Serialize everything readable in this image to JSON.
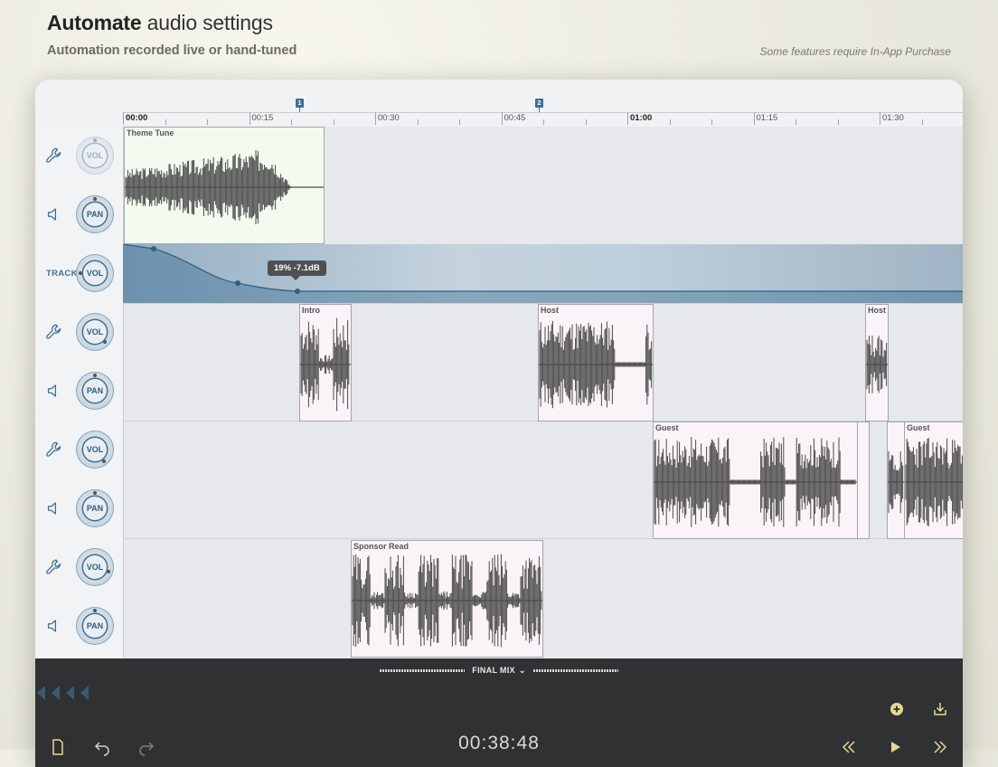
{
  "promo": {
    "title_bold": "Automate",
    "title_rest": " audio settings",
    "subtitle": "Automation recorded live or hand-tuned",
    "note": "Some features require In-App Purchase"
  },
  "ruler": {
    "ticks": [
      "00:00",
      "00:15",
      "00:30",
      "00:45",
      "01:00",
      "01:15",
      "01:30"
    ],
    "markers": [
      "1",
      "2"
    ]
  },
  "controls": {
    "vol_label": "VOL",
    "pan_label": "PAN",
    "track_label": "TRACK"
  },
  "clips": {
    "theme": "Theme Tune",
    "intro": "Intro",
    "host1": "Host",
    "host2": "Host",
    "guest1": "Guest",
    "guest2": "Guest",
    "sponsor": "Sponsor Read"
  },
  "automation": {
    "tooltip": "19% -7.1dB"
  },
  "transport": {
    "mix_label": "FINAL MIX",
    "timecode": "00:38:48"
  },
  "colors": {
    "accent": "#3f6f94",
    "panel_dark": "#2f3133",
    "clip_green": "#f3fbf0",
    "clip_pink": "#faf3f8"
  }
}
